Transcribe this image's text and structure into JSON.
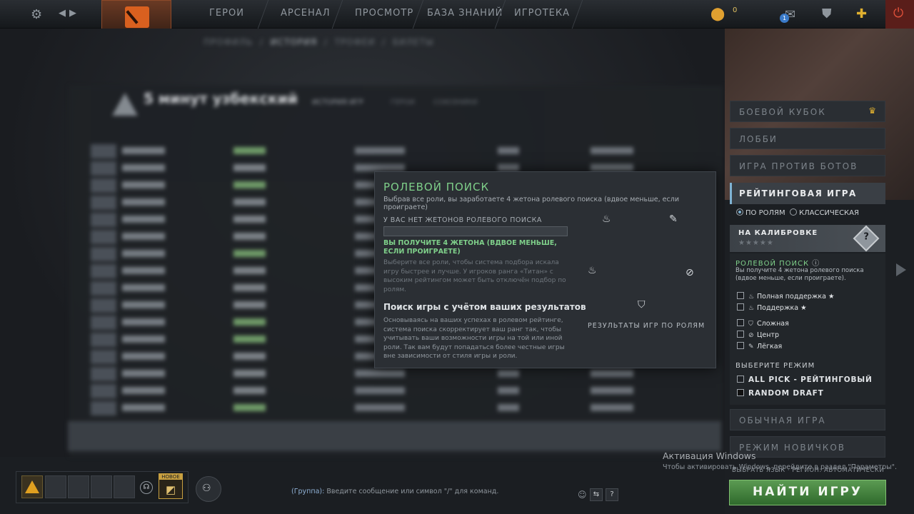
{
  "topbar": {
    "nav": [
      "ГЕРОИ",
      "АРСЕНАЛ",
      "ПРОСМОТР",
      "БАЗА ЗНАНИЙ",
      "ИГРОТЕКА"
    ],
    "shards": "0",
    "notif_count": "1"
  },
  "profile": {
    "tabs": [
      "ПРОФИЛЬ",
      "ИСТОРИЯ",
      "ТРОФЕИ",
      "БИЛЕТЫ"
    ],
    "player_name": "5 минут узбекский",
    "sub_tabs": [
      "ИСТОРИЯ ИГР",
      "ГЕРОИ",
      "СОЮЗНИКИ"
    ]
  },
  "popup": {
    "title": "РОЛЕВОЙ ПОИСК",
    "subtitle": "Выбрав все роли, вы заработаете 4 жетона ролевого поиска (вдвое меньше, если проиграете)",
    "tokens_label": "У ВАС НЕТ ЖЕТОНОВ РОЛЕВОГО ПОИСКА",
    "tokens_progress": 0,
    "reward_text": "ВЫ ПОЛУЧИТЕ 4 ЖЕТОНА (ВДВОЕ МЕНЬШЕ, ЕСЛИ ПРОИГРАЕТЕ)",
    "description": "Выберите все роли, чтобы система подбора искала игру быстрее и лучше. У игроков ранга «Титан» с высоким рейтингом может быть отключён подбор по ролям.",
    "heading2": "Поиск игры с учётом ваших результатов",
    "description2": "Основываясь на ваших успехах в ролевом рейтинге, система поиска скорректирует ваш ранг так, чтобы учитывать ваши возможности игры на той или иной роли. Так вам будут попадаться более честные игры вне зависимости от стиля игры и роли.",
    "results_label": "РЕЗУЛЬТАТЫ ИГР ПО РОЛЯМ"
  },
  "sidebar": {
    "battle_cup": "БОЕВОЙ КУБОК",
    "lobby": "ЛОББИ",
    "bots": "ИГРА ПРОТИВ БОТОВ",
    "ranked": "РЕЙТИНГОВАЯ ИГРА",
    "radio_roles": "ПО РОЛЯМ",
    "radio_classic": "КЛАССИЧЕСКАЯ",
    "calibration": "НА КАЛИБРОВКЕ",
    "calibration_stars": "★★★★★",
    "role_search_title": "РОЛЕВОЙ ПОИСК",
    "role_search_desc": "Вы получите 4 жетона ролевого поиска (вдвое меньше, если проиграете).",
    "roles": [
      {
        "label": "Полная поддержка ★",
        "icon": "full-support-icon"
      },
      {
        "label": "Поддержка ★",
        "icon": "support-icon"
      },
      {
        "label": "Сложная",
        "icon": "offlane-icon"
      },
      {
        "label": "Центр",
        "icon": "mid-icon"
      },
      {
        "label": "Лёгкая",
        "icon": "safelane-icon"
      }
    ],
    "mode_title": "ВЫБЕРИТЕ РЕЖИМ",
    "modes": [
      "ALL PICK - РЕЙТИНГОВЫЙ",
      "RANDOM DRAFT"
    ],
    "normal": "ОБЫЧНАЯ ИГРА",
    "newbie": "РЕЖИМ НОВИЧКОВ",
    "lang_region": "ВЫБРАТЬ ЯЗЫК · РЕГИОН: АВТОМАТИЧЕСКИ",
    "find_game": "НАЙТИ ИГРУ"
  },
  "windows": {
    "activation_title": "Активация Windows",
    "activation_text": "Чтобы активировать Windows, перейдите в раздел \"Параметры\"."
  },
  "bottom": {
    "new_badge": "НОВОЕ",
    "chat_group": "(Группа):",
    "chat_placeholder": "Введите сообщение или символ \"/\" для команд.",
    "help": "?"
  },
  "colors": {
    "accent_green": "#7fd08a",
    "accent_blue": "#7fb3d4",
    "play_green": "#3f8a3a"
  }
}
